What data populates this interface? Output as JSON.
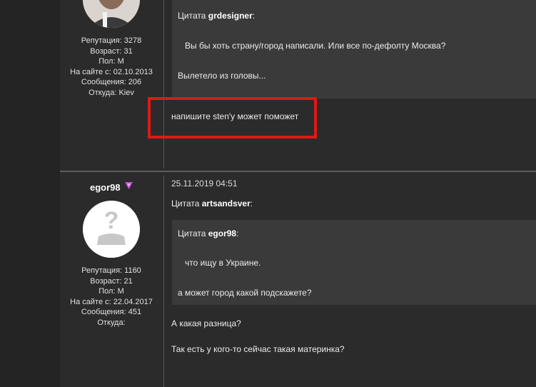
{
  "post1": {
    "reputation": "Репутация: 3278",
    "age": "Возраст: 31",
    "gender": "Пол: М",
    "since": "На сайте с: 02.10.2013",
    "messages": "Сообщения: 206",
    "location": "Откуда: Kiev",
    "quote_prefix": "Цитата ",
    "quote_author": "grdesigner",
    "quote_suffix": ":",
    "quote_line1": "Вы бы хоть страну/город написали. Или все по-дефолту Москва?",
    "quote_line2": "Вылетело из головы...",
    "reply": "напишите sten'у может поможет"
  },
  "post2": {
    "username": "egor98",
    "badge_icon": "triangle-badge-icon",
    "date": "25.11.2019 04:51",
    "reputation": "Репутация: 1160",
    "age": "Возраст: 21",
    "gender": "Пол: М",
    "since": "На сайте с: 22.04.2017",
    "messages": "Сообщения: 451",
    "location": "Откуда:",
    "outer_quote_prefix": "Цитата ",
    "outer_quote_author": "artsandsver",
    "outer_quote_suffix": ":",
    "inner_quote_prefix": "Цитата ",
    "inner_quote_author": "egor98",
    "inner_quote_suffix": ":",
    "inner_quote_text": "что ищу в Украине.",
    "outer_quote_text": "а может город какой подскажете?",
    "reply_line1": "А какая разница?",
    "reply_line2": "Так есть у кого-то сейчас такая материнка?"
  },
  "colors": {
    "highlight": "#e01818",
    "badge": "#c34fd6"
  }
}
